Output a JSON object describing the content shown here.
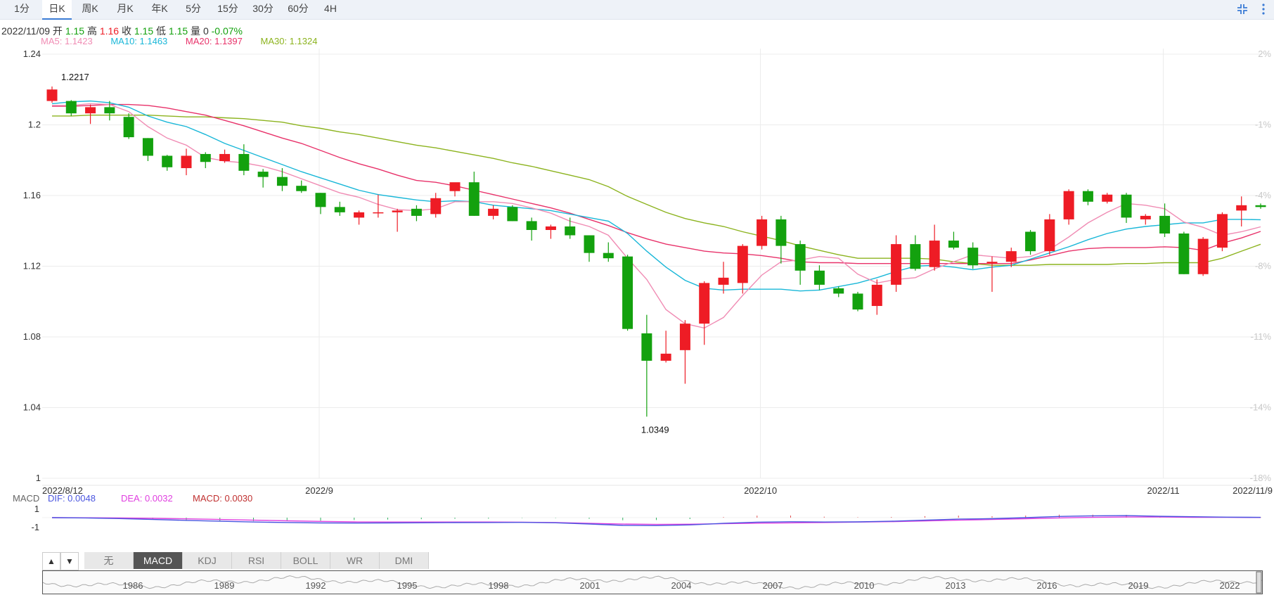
{
  "tabs": [
    "1分",
    "日K",
    "周K",
    "月K",
    "年K",
    "5分",
    "15分",
    "30分",
    "60分",
    "4H"
  ],
  "active_tab": "日K",
  "ohlc": {
    "date": "2022/11/09",
    "open_label": "开",
    "open": "1.15",
    "high_label": "高",
    "high": "1.16",
    "close_label": "收",
    "close": "1.15",
    "low_label": "低",
    "low": "1.15",
    "volume_label": "量",
    "volume": "0",
    "change": "-0.07%"
  },
  "ma_legend": [
    {
      "label": "MA5: 1.1423",
      "color": "#f08cb4"
    },
    {
      "label": "MA10: 1.1463",
      "color": "#19b7d8"
    },
    {
      "label": "MA20: 1.1397",
      "color": "#e8326a"
    },
    {
      "label": "MA30: 1.1324",
      "color": "#8cb31e"
    }
  ],
  "macd_legend": {
    "name": "MACD",
    "items": [
      {
        "label": "DIF: 0.0048",
        "color": "#4a55e0"
      },
      {
        "label": "DEA: 0.0032",
        "color": "#e040e0"
      },
      {
        "label": "MACD: 0.0030",
        "color": "#c03030"
      }
    ]
  },
  "indicator_tabs": [
    "无",
    "MACD",
    "KDJ",
    "RSI",
    "BOLL",
    "WR",
    "DMI"
  ],
  "active_indicator": "MACD",
  "navigator_years": [
    "1986",
    "1989",
    "1992",
    "1995",
    "1998",
    "2001",
    "2004",
    "2007",
    "2010",
    "2013",
    "2016",
    "2019",
    "2022"
  ],
  "colors": {
    "up": "#ee1c25",
    "down": "#13a10e",
    "ma5": "#f08cb4",
    "ma10": "#19b7d8",
    "ma20": "#e8326a",
    "ma30": "#8cb31e"
  },
  "chart_data": {
    "type": "candlestick",
    "title": "",
    "ylim": [
      1.0,
      1.24
    ],
    "y_ticks": [
      "1.24",
      "1.2",
      "1.16",
      "1.12",
      "1.08",
      "1.04",
      "1"
    ],
    "right_ticks": [
      "2%",
      "-1%",
      "-4%",
      "-8%",
      "-11%",
      "-14%",
      "-18%"
    ],
    "x_labels": [
      "2022/8/12",
      "2022/9",
      "2022/10",
      "2022/11",
      "2022/11/9"
    ],
    "high_annotation": "1.2217",
    "low_annotation": "1.0349",
    "candles": [
      {
        "o": 1.2135,
        "h": 1.2217,
        "l": 1.2125,
        "c": 1.22
      },
      {
        "o": 1.2135,
        "h": 1.214,
        "l": 1.205,
        "c": 1.2065
      },
      {
        "o": 1.2065,
        "h": 1.2115,
        "l": 1.2005,
        "c": 1.21
      },
      {
        "o": 1.21,
        "h": 1.2135,
        "l": 1.2025,
        "c": 1.2065
      },
      {
        "o": 1.2045,
        "h": 1.2065,
        "l": 1.192,
        "c": 1.193
      },
      {
        "o": 1.1925,
        "h": 1.1925,
        "l": 1.1795,
        "c": 1.1825
      },
      {
        "o": 1.1825,
        "h": 1.183,
        "l": 1.174,
        "c": 1.176
      },
      {
        "o": 1.1755,
        "h": 1.1865,
        "l": 1.1715,
        "c": 1.1825
      },
      {
        "o": 1.1835,
        "h": 1.1845,
        "l": 1.1755,
        "c": 1.179
      },
      {
        "o": 1.1795,
        "h": 1.186,
        "l": 1.1785,
        "c": 1.1835
      },
      {
        "o": 1.1835,
        "h": 1.189,
        "l": 1.1715,
        "c": 1.174
      },
      {
        "o": 1.1735,
        "h": 1.175,
        "l": 1.1645,
        "c": 1.1705
      },
      {
        "o": 1.1705,
        "h": 1.1755,
        "l": 1.1625,
        "c": 1.1655
      },
      {
        "o": 1.1655,
        "h": 1.1685,
        "l": 1.1615,
        "c": 1.1625
      },
      {
        "o": 1.1615,
        "h": 1.1615,
        "l": 1.1495,
        "c": 1.1535
      },
      {
        "o": 1.1535,
        "h": 1.1565,
        "l": 1.1485,
        "c": 1.1505
      },
      {
        "o": 1.1475,
        "h": 1.1515,
        "l": 1.1435,
        "c": 1.1505
      },
      {
        "o": 1.1505,
        "h": 1.1605,
        "l": 1.1475,
        "c": 1.1505
      },
      {
        "o": 1.1505,
        "h": 1.1525,
        "l": 1.1395,
        "c": 1.1515
      },
      {
        "o": 1.1525,
        "h": 1.1545,
        "l": 1.1455,
        "c": 1.1485
      },
      {
        "o": 1.1495,
        "h": 1.1615,
        "l": 1.1475,
        "c": 1.1585
      },
      {
        "o": 1.1625,
        "h": 1.1645,
        "l": 1.1595,
        "c": 1.1675
      },
      {
        "o": 1.1675,
        "h": 1.1735,
        "l": 1.1485,
        "c": 1.1485
      },
      {
        "o": 1.1485,
        "h": 1.1545,
        "l": 1.1465,
        "c": 1.1525
      },
      {
        "o": 1.1535,
        "h": 1.1545,
        "l": 1.1455,
        "c": 1.1455
      },
      {
        "o": 1.1455,
        "h": 1.1475,
        "l": 1.1345,
        "c": 1.1405
      },
      {
        "o": 1.1405,
        "h": 1.1435,
        "l": 1.1355,
        "c": 1.1425
      },
      {
        "o": 1.1425,
        "h": 1.1475,
        "l": 1.1355,
        "c": 1.1375
      },
      {
        "o": 1.1375,
        "h": 1.1375,
        "l": 1.1225,
        "c": 1.1275
      },
      {
        "o": 1.1275,
        "h": 1.1335,
        "l": 1.1225,
        "c": 1.1245
      },
      {
        "o": 1.1255,
        "h": 1.1265,
        "l": 1.0835,
        "c": 1.0845
      },
      {
        "o": 1.082,
        "h": 1.0925,
        "l": 1.0349,
        "c": 1.0665
      },
      {
        "o": 1.0665,
        "h": 1.0835,
        "l": 1.0655,
        "c": 1.0705
      },
      {
        "o": 1.0725,
        "h": 1.0895,
        "l": 1.0535,
        "c": 1.0875
      },
      {
        "o": 1.0875,
        "h": 1.1115,
        "l": 1.0755,
        "c": 1.1105
      },
      {
        "o": 1.1095,
        "h": 1.1225,
        "l": 1.1045,
        "c": 1.1135
      },
      {
        "o": 1.1105,
        "h": 1.1325,
        "l": 1.1045,
        "c": 1.1315
      },
      {
        "o": 1.1315,
        "h": 1.1485,
        "l": 1.1295,
        "c": 1.1465
      },
      {
        "o": 1.1465,
        "h": 1.1485,
        "l": 1.1215,
        "c": 1.1315
      },
      {
        "o": 1.1325,
        "h": 1.1345,
        "l": 1.1095,
        "c": 1.1175
      },
      {
        "o": 1.1175,
        "h": 1.1205,
        "l": 1.1065,
        "c": 1.1095
      },
      {
        "o": 1.1075,
        "h": 1.1085,
        "l": 1.1025,
        "c": 1.1045
      },
      {
        "o": 1.1045,
        "h": 1.1055,
        "l": 1.0945,
        "c": 1.0955
      },
      {
        "o": 1.0975,
        "h": 1.1125,
        "l": 1.0925,
        "c": 1.1095
      },
      {
        "o": 1.1095,
        "h": 1.1375,
        "l": 1.1055,
        "c": 1.1325
      },
      {
        "o": 1.1325,
        "h": 1.1375,
        "l": 1.1175,
        "c": 1.1185
      },
      {
        "o": 1.1195,
        "h": 1.1435,
        "l": 1.1175,
        "c": 1.1345
      },
      {
        "o": 1.1345,
        "h": 1.1395,
        "l": 1.1295,
        "c": 1.1305
      },
      {
        "o": 1.1305,
        "h": 1.1335,
        "l": 1.1185,
        "c": 1.1205
      },
      {
        "o": 1.1215,
        "h": 1.1255,
        "l": 1.1055,
        "c": 1.1225
      },
      {
        "o": 1.1225,
        "h": 1.1305,
        "l": 1.1195,
        "c": 1.1285
      },
      {
        "o": 1.1395,
        "h": 1.1405,
        "l": 1.1265,
        "c": 1.1285
      },
      {
        "o": 1.1285,
        "h": 1.1495,
        "l": 1.1265,
        "c": 1.1465
      },
      {
        "o": 1.1465,
        "h": 1.1635,
        "l": 1.1435,
        "c": 1.1625
      },
      {
        "o": 1.1625,
        "h": 1.1635,
        "l": 1.1545,
        "c": 1.1565
      },
      {
        "o": 1.1565,
        "h": 1.1615,
        "l": 1.1555,
        "c": 1.1605
      },
      {
        "o": 1.1605,
        "h": 1.1615,
        "l": 1.1445,
        "c": 1.1475
      },
      {
        "o": 1.1465,
        "h": 1.1495,
        "l": 1.1435,
        "c": 1.1485
      },
      {
        "o": 1.1485,
        "h": 1.1555,
        "l": 1.1365,
        "c": 1.1385
      },
      {
        "o": 1.1385,
        "h": 1.1395,
        "l": 1.1155,
        "c": 1.1155
      },
      {
        "o": 1.1155,
        "h": 1.1365,
        "l": 1.1145,
        "c": 1.1355
      },
      {
        "o": 1.1305,
        "h": 1.1505,
        "l": 1.1285,
        "c": 1.1495
      },
      {
        "o": 1.1515,
        "h": 1.1595,
        "l": 1.1425,
        "c": 1.1545
      },
      {
        "o": 1.1545,
        "h": 1.1555,
        "l": 1.1525,
        "c": 1.1535
      }
    ],
    "ma_series": {
      "ma5": [
        1.211,
        1.211,
        1.212,
        1.2115,
        1.2075,
        1.199,
        1.1925,
        1.1885,
        1.1815,
        1.1795,
        1.1785,
        1.1765,
        1.1735,
        1.1695,
        1.1655,
        1.1615,
        1.159,
        1.155,
        1.152,
        1.1515,
        1.1525,
        1.1565,
        1.1565,
        1.1565,
        1.1555,
        1.153,
        1.15,
        1.1455,
        1.1425,
        1.1375,
        1.1245,
        1.1125,
        1.0955,
        1.0875,
        1.085,
        1.091,
        1.1035,
        1.115,
        1.1225,
        1.1235,
        1.1255,
        1.1245,
        1.1155,
        1.1105,
        1.1125,
        1.1135,
        1.1185,
        1.1225,
        1.1265,
        1.1255,
        1.1245,
        1.1255,
        1.1295,
        1.1365,
        1.1445,
        1.1505,
        1.1555,
        1.1545,
        1.1525,
        1.145,
        1.142,
        1.1375,
        1.1395,
        1.1423
      ],
      "ma10": [
        1.212,
        1.213,
        1.2135,
        1.2125,
        1.21,
        1.205,
        1.2015,
        1.199,
        1.1945,
        1.1895,
        1.1855,
        1.1815,
        1.1775,
        1.1735,
        1.17,
        1.1665,
        1.163,
        1.1605,
        1.159,
        1.1575,
        1.1565,
        1.157,
        1.1565,
        1.1545,
        1.1535,
        1.1525,
        1.1515,
        1.1495,
        1.1475,
        1.1455,
        1.1385,
        1.1285,
        1.1195,
        1.112,
        1.1075,
        1.1065,
        1.107,
        1.107,
        1.107,
        1.106,
        1.1065,
        1.1085,
        1.1105,
        1.1135,
        1.117,
        1.12,
        1.1205,
        1.1195,
        1.118,
        1.1195,
        1.1205,
        1.124,
        1.1275,
        1.131,
        1.135,
        1.1385,
        1.141,
        1.1425,
        1.1435,
        1.1445,
        1.1445,
        1.1465,
        1.1465,
        1.1463
      ],
      "ma20": [
        1.2105,
        1.2105,
        1.211,
        1.2115,
        1.2115,
        1.211,
        1.2095,
        1.2075,
        1.2055,
        1.2025,
        1.1995,
        1.196,
        1.1925,
        1.1895,
        1.1855,
        1.1815,
        1.178,
        1.175,
        1.1715,
        1.1685,
        1.1675,
        1.1655,
        1.163,
        1.1605,
        1.158,
        1.1555,
        1.153,
        1.15,
        1.1465,
        1.143,
        1.139,
        1.1355,
        1.1325,
        1.1305,
        1.1285,
        1.1275,
        1.127,
        1.126,
        1.1245,
        1.1225,
        1.122,
        1.122,
        1.1215,
        1.1215,
        1.1215,
        1.1215,
        1.1215,
        1.1215,
        1.1215,
        1.1215,
        1.1215,
        1.1235,
        1.126,
        1.1285,
        1.13,
        1.1305,
        1.1305,
        1.1305,
        1.131,
        1.1305,
        1.129,
        1.133,
        1.136,
        1.1397
      ],
      "ma30": [
        1.205,
        1.205,
        1.2055,
        1.2055,
        1.2055,
        1.2055,
        1.205,
        1.2045,
        1.2045,
        1.204,
        1.2035,
        1.2025,
        1.2015,
        1.1995,
        1.198,
        1.196,
        1.1945,
        1.1925,
        1.1905,
        1.1885,
        1.187,
        1.185,
        1.183,
        1.181,
        1.1785,
        1.1765,
        1.174,
        1.1715,
        1.169,
        1.165,
        1.1595,
        1.155,
        1.1505,
        1.147,
        1.1445,
        1.1425,
        1.1395,
        1.137,
        1.1345,
        1.1315,
        1.129,
        1.1265,
        1.1245,
        1.1245,
        1.1245,
        1.1245,
        1.124,
        1.1225,
        1.1215,
        1.1205,
        1.1205,
        1.1205,
        1.121,
        1.121,
        1.121,
        1.121,
        1.1215,
        1.1215,
        1.122,
        1.122,
        1.122,
        1.1245,
        1.1285,
        1.1324
      ]
    },
    "macd": {
      "ylim_labels": [
        "1",
        "-1"
      ],
      "dif": [
        0,
        -0.05,
        -0.15,
        -0.3,
        -0.45,
        -0.6,
        -0.72,
        -0.8,
        -0.88,
        -0.9,
        -0.88,
        -0.85,
        -0.82,
        -0.8,
        -0.78,
        -0.85,
        -1.05,
        -1.28,
        -1.32,
        -1.2,
        -0.95,
        -0.75,
        -0.68,
        -0.72,
        -0.7,
        -0.6,
        -0.42,
        -0.25,
        -0.18,
        0.0,
        0.2,
        0.3,
        0.34,
        0.22,
        0.15,
        0.08,
        0.05
      ],
      "dea": [
        0,
        -0.02,
        -0.06,
        -0.12,
        -0.2,
        -0.3,
        -0.42,
        -0.52,
        -0.62,
        -0.7,
        -0.72,
        -0.72,
        -0.72,
        -0.72,
        -0.75,
        -0.82,
        -0.95,
        -1.06,
        -1.12,
        -1.08,
        -1.0,
        -0.92,
        -0.86,
        -0.8,
        -0.74,
        -0.66,
        -0.55,
        -0.42,
        -0.3,
        -0.18,
        -0.05,
        0.05,
        0.1,
        0.1,
        0.06,
        0.05,
        0.02
      ]
    }
  }
}
